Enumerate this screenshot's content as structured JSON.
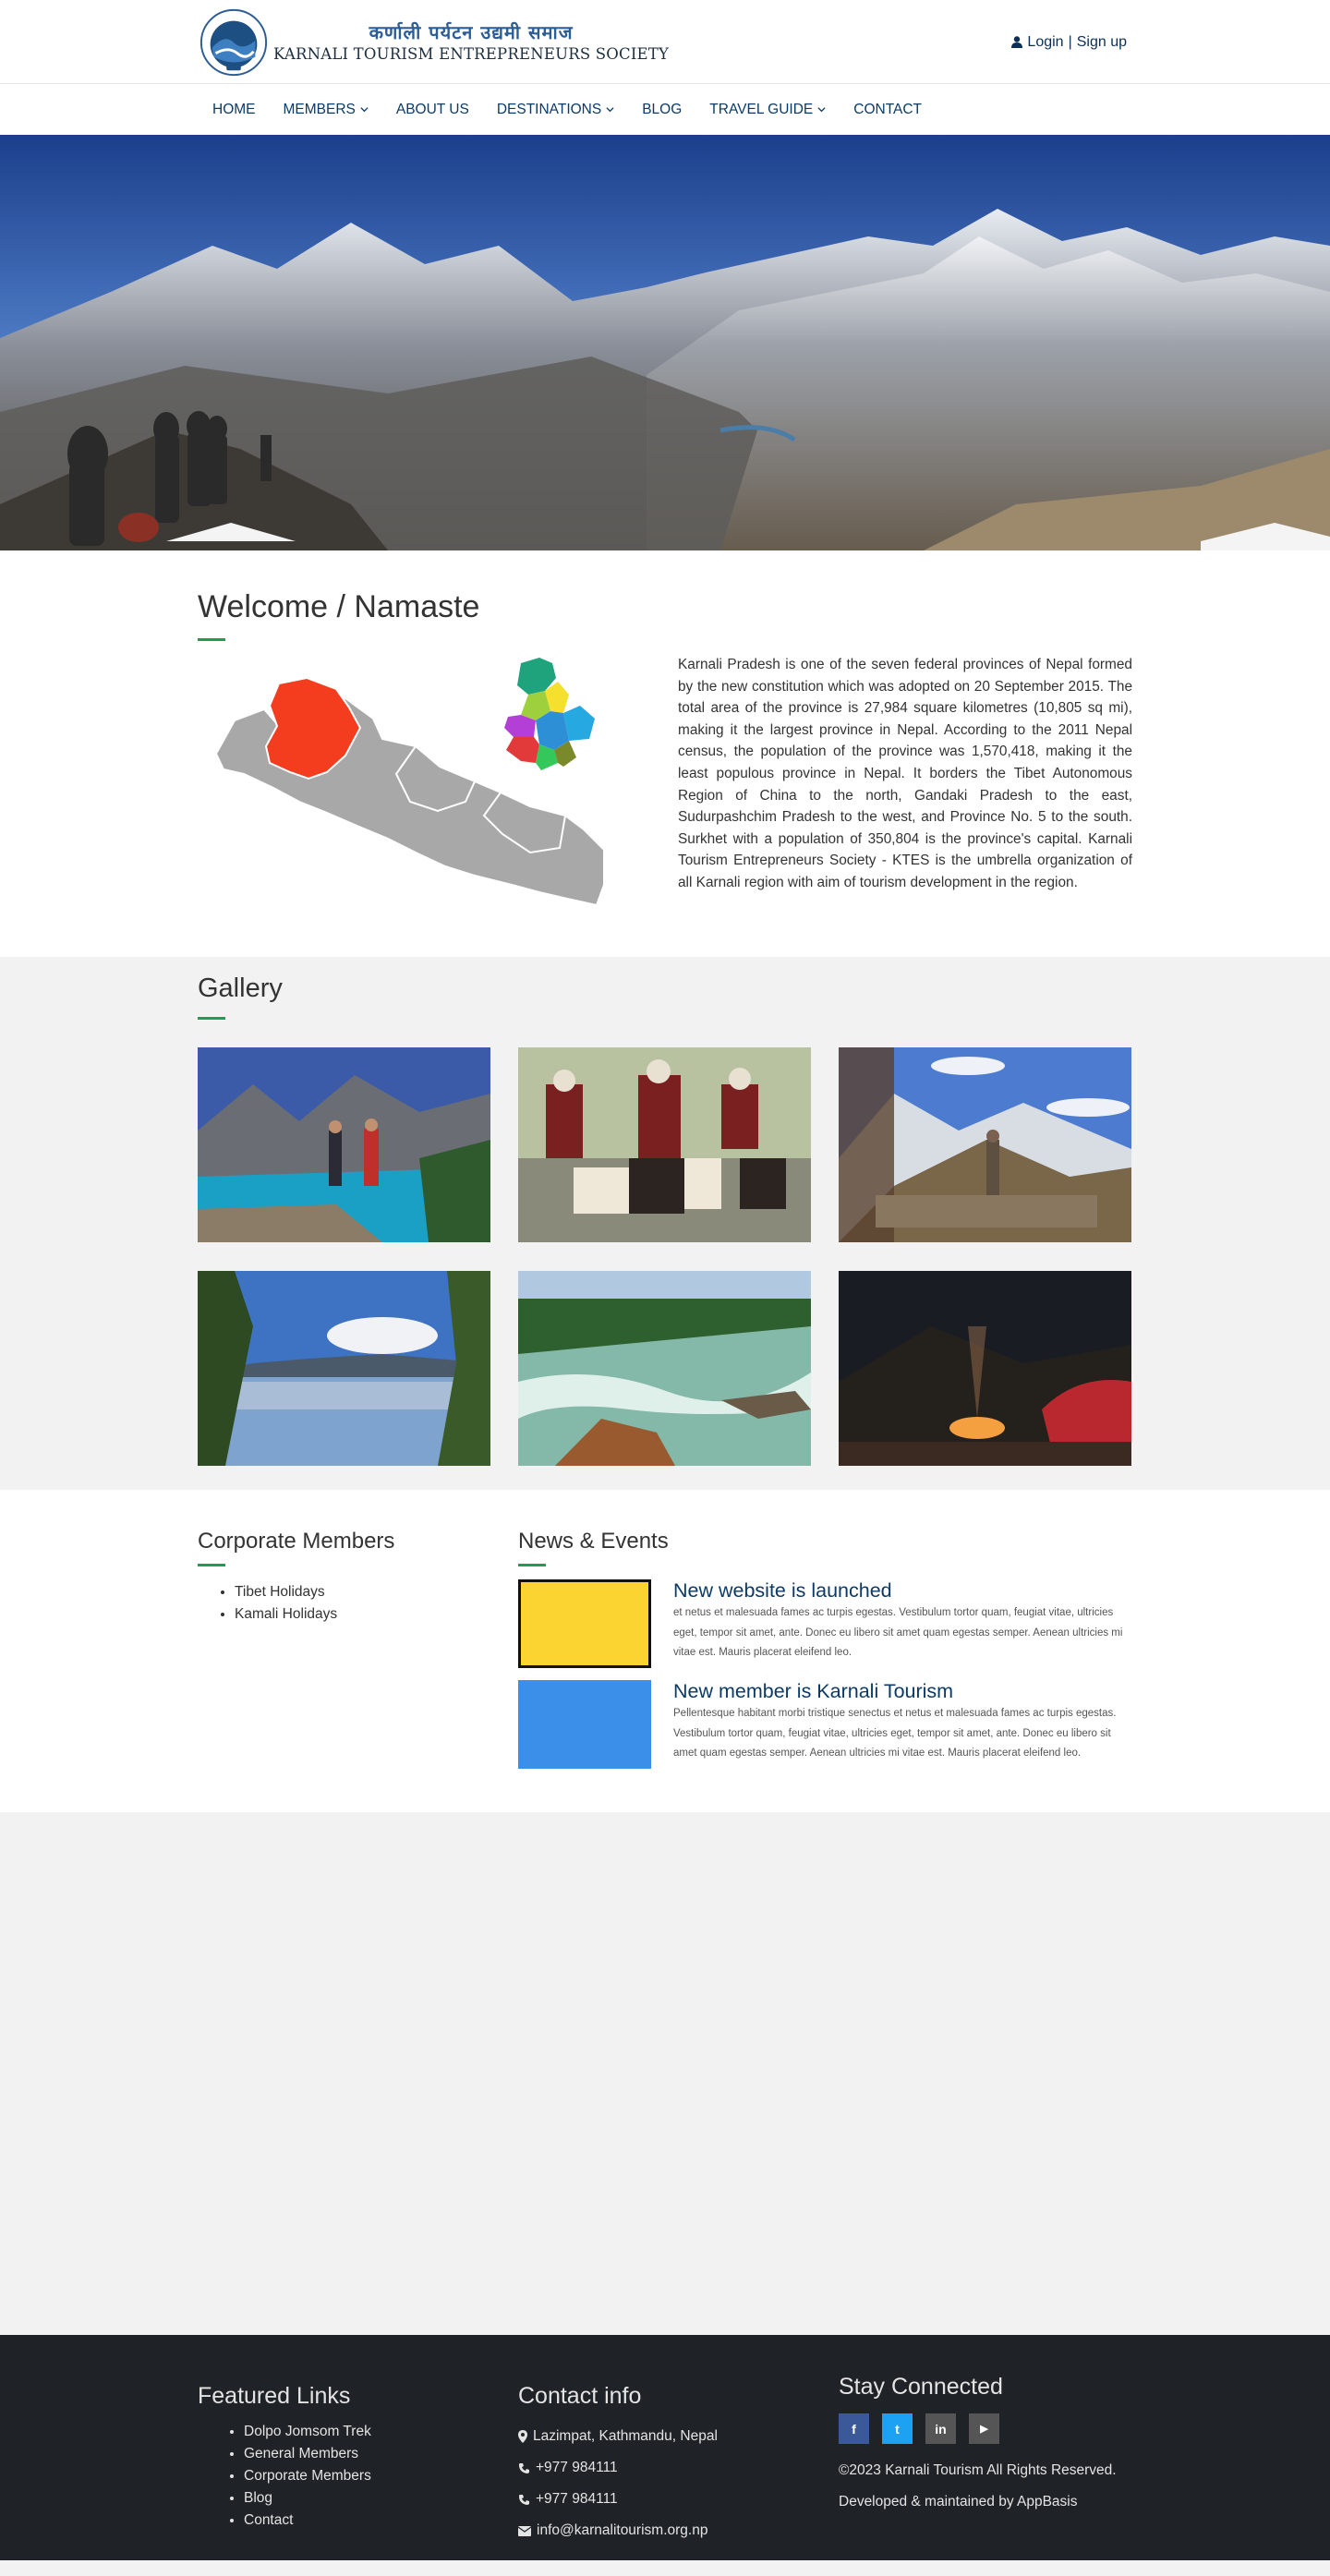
{
  "header": {
    "logo_nepali": "कर्णाली पर्यटन उद्यमी समाज",
    "logo_english": "KARNALI TOURISM ENTREPRENEURS SOCIETY",
    "login": "Login",
    "separator": "|",
    "signup": "Sign up"
  },
  "nav": {
    "items": [
      {
        "label": "HOME"
      },
      {
        "label": "MEMBERS"
      },
      {
        "label": "ABOUT US"
      },
      {
        "label": "DESTINATIONS"
      },
      {
        "label": "BLOG"
      },
      {
        "label": "TRAVEL GUIDE"
      },
      {
        "label": "CONTACT"
      }
    ]
  },
  "welcome": {
    "title": "Welcome / Namaste",
    "body": "Karnali Pradesh is one of the seven federal provinces of Nepal formed by the new constitution which was adopted on 20 September 2015. The total area of the province is 27,984 square kilometres (10,805 sq mi), making it the largest province in Nepal. According to the 2011 Nepal census, the population of the province was 1,570,418, making it the least populous province in Nepal. It borders the Tibet Autonomous Region of China to the north, Gandaki Pradesh to the east, Sudurpashchim Pradesh to the west, and Province No. 5 to the south. Surkhet with a population of 350,804 is the province's capital. Karnali Tourism Entrepreneurs Society - KTES is the umbrella organization of all Karnali region with aim of tourism development in the region."
  },
  "gallery": {
    "title": "Gallery"
  },
  "members": {
    "title": "Corporate Members",
    "items": [
      "Tibet Holidays",
      "Kamali Holidays"
    ]
  },
  "news": {
    "title": "News & Events",
    "items": [
      {
        "title": "New website is launched",
        "desc": "et netus et malesuada fames ac turpis egestas. Vestibulum tortor quam, feugiat vitae, ultricies eget, tempor sit amet, ante. Donec eu libero sit amet quam egestas semper. Aenean ultricies mi vitae est. Mauris placerat eleifend leo.",
        "thumb_color": "#fbd431"
      },
      {
        "title": "New member is Karnali Tourism",
        "desc": "Pellentesque habitant morbi tristique senectus et netus et malesuada fames ac turpis egestas. Vestibulum tortor quam, feugiat vitae, ultricies eget, tempor sit amet, ante. Donec eu libero sit amet quam egestas semper. Aenean ultricies mi vitae est. Mauris placerat eleifend leo.",
        "thumb_color": "#3b8fe8"
      }
    ]
  },
  "footer": {
    "links_title": "Featured Links",
    "links": [
      "Dolpo Jomsom Trek",
      "General Members",
      "Corporate Members",
      "Blog",
      "Contact"
    ],
    "contact_title": "Contact info",
    "address": "Lazimpat, Kathmandu, Nepal",
    "phone1": "+977 984111",
    "phone2": "+977 984111",
    "email": "info@karnalitourism.org.np",
    "stay_title": "Stay Connected",
    "social": [
      {
        "icon": "facebook-icon",
        "glyph": "f",
        "color": "#3b5998"
      },
      {
        "icon": "twitter-icon",
        "glyph": "t",
        "color": "#1da1f2"
      },
      {
        "icon": "linkedin-icon",
        "glyph": "in",
        "color": "#555555"
      },
      {
        "icon": "youtube-icon",
        "glyph": "▶",
        "color": "#555555"
      }
    ],
    "copyright": "©2023 Karnali Tourism All Rights Reserved.",
    "developed": "Developed & maintained by AppBasis"
  },
  "colors": {
    "primary": "#0b3a66",
    "accent": "#1f9d55",
    "footer_bg": "#1f2226"
  }
}
